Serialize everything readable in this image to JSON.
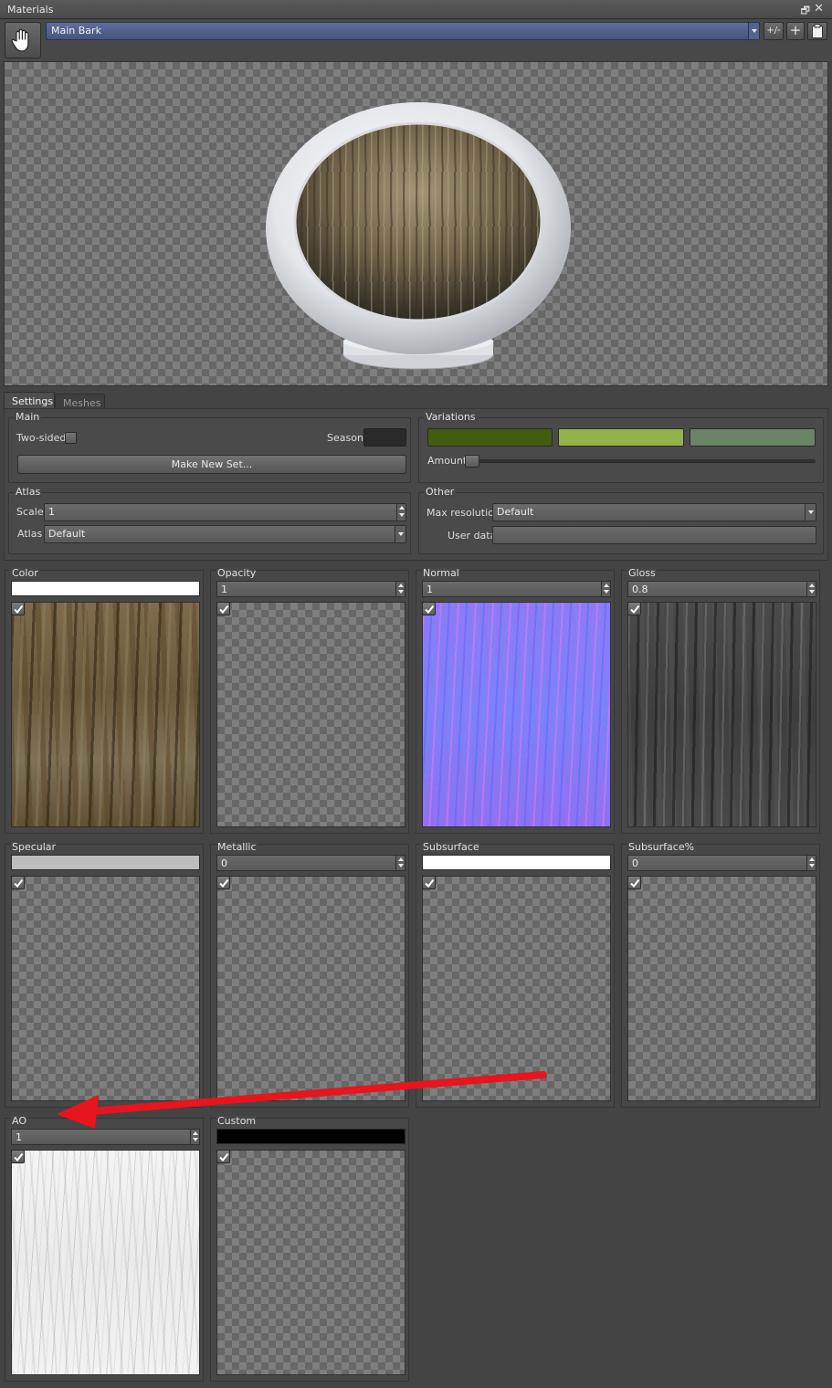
{
  "window": {
    "title": "Materials"
  },
  "toolbar": {
    "material": "Main Bark",
    "plus_minus_label": "+/-",
    "add_icon": "plus-icon",
    "paste_icon": "clipboard-icon",
    "hand_icon": "hand-icon"
  },
  "tabs": [
    {
      "label": "Settings",
      "active": true
    },
    {
      "label": "Meshes",
      "active": false
    }
  ],
  "main": {
    "title": "Main",
    "two_sided_label": "Two-sided",
    "two_sided_checked": false,
    "season_label": "Season",
    "season_color": "#2a2a2a",
    "make_new_set_label": "Make New Set..."
  },
  "variations": {
    "title": "Variations",
    "colors": [
      "#445c10",
      "#93b24c",
      "#6a8466"
    ],
    "amount_label": "Amount",
    "amount_value": 0.0
  },
  "atlas": {
    "title": "Atlas",
    "scale_label": "Scale",
    "scale_value": "1",
    "atlas_label": "Atlas",
    "atlas_value": "Default"
  },
  "other": {
    "title": "Other",
    "max_res_label": "Max resolution",
    "max_res_value": "Default",
    "user_data_label": "User data",
    "user_data_value": ""
  },
  "maps": {
    "color": {
      "label": "Color",
      "swatch": "#ffffff",
      "checked": true
    },
    "opacity": {
      "label": "Opacity",
      "value": "1",
      "checked": true
    },
    "normal": {
      "label": "Normal",
      "value": "1",
      "checked": true
    },
    "gloss": {
      "label": "Gloss",
      "value": "0.8",
      "checked": true
    },
    "specular": {
      "label": "Specular",
      "swatch": "#bdbdbd",
      "checked": true
    },
    "metallic": {
      "label": "Metallic",
      "value": "0",
      "checked": true
    },
    "subsurface": {
      "label": "Subsurface",
      "swatch": "#ffffff",
      "checked": true
    },
    "subsurface_pct": {
      "label": "Subsurface%",
      "value": "0",
      "checked": true
    },
    "ao": {
      "label": "AO",
      "value": "1",
      "checked": true
    },
    "custom": {
      "label": "Custom",
      "swatch": "#000000",
      "checked": true
    }
  },
  "annotation": {
    "arrow_color": "#e8141e"
  }
}
